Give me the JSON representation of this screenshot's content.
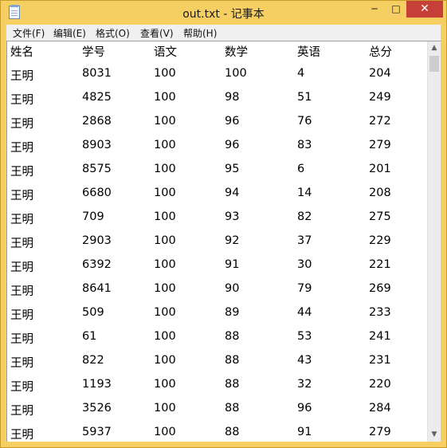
{
  "window": {
    "title": "out.txt - 记事本",
    "controls": {
      "minimize": "─",
      "maximize": "□",
      "close": "✕"
    }
  },
  "menu": [
    "文件(F)",
    "编辑(E)",
    "格式(O)",
    "查看(V)",
    "帮助(H)"
  ],
  "table": {
    "headers": [
      "姓名",
      "学号",
      "语文",
      "数学",
      "英语",
      "总分"
    ],
    "rows": [
      [
        "王明",
        "8031",
        "100",
        "100",
        "4",
        "204"
      ],
      [
        "王明",
        "4825",
        "100",
        "98",
        "51",
        "249"
      ],
      [
        "王明",
        "2868",
        "100",
        "96",
        "76",
        "272"
      ],
      [
        "王明",
        "8903",
        "100",
        "96",
        "83",
        "279"
      ],
      [
        "王明",
        "8575",
        "100",
        "95",
        "6",
        "201"
      ],
      [
        "王明",
        "6680",
        "100",
        "94",
        "14",
        "208"
      ],
      [
        "王明",
        "709",
        "100",
        "93",
        "82",
        "275"
      ],
      [
        "王明",
        "2903",
        "100",
        "92",
        "37",
        "229"
      ],
      [
        "王明",
        "6392",
        "100",
        "91",
        "30",
        "221"
      ],
      [
        "王明",
        "8641",
        "100",
        "90",
        "79",
        "269"
      ],
      [
        "王明",
        "509",
        "100",
        "89",
        "44",
        "233"
      ],
      [
        "王明",
        "61",
        "100",
        "88",
        "53",
        "241"
      ],
      [
        "王明",
        "822",
        "100",
        "88",
        "43",
        "231"
      ],
      [
        "王明",
        "1193",
        "100",
        "88",
        "32",
        "220"
      ],
      [
        "王明",
        "3526",
        "100",
        "88",
        "96",
        "284"
      ],
      [
        "王明",
        "5937",
        "100",
        "88",
        "91",
        "279"
      ]
    ]
  },
  "scrollbar": {
    "up_icon": "up-arrow-icon",
    "down_icon": "down-arrow-icon",
    "up": "▲",
    "down": "▼"
  }
}
